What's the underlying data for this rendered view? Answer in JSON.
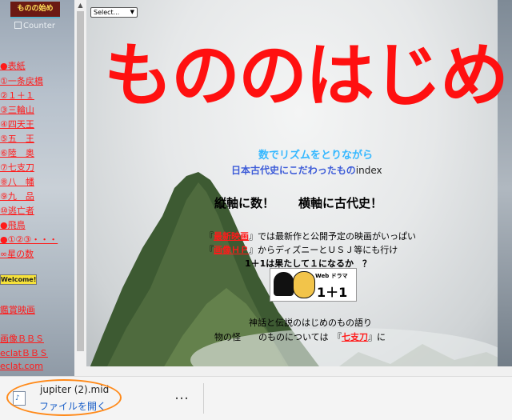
{
  "sidebar": {
    "logo_text": "ものの始め",
    "counter_alt": "Counter",
    "items": [
      "●表紙",
      "①一条戻橋",
      "②１＋１",
      "③三輪山",
      "④四天王",
      "⑤五　王",
      "⑥陸　奥",
      "⑦七支刀",
      "⑧八　幡",
      "⑨九　品",
      "⑩逃亡者",
      "●飛鳥",
      "●①②③・・・",
      "∞星の数"
    ],
    "welcome": "Welcome!",
    "lower_items": [
      "鑑賞映画",
      "画像ＢＢＳ",
      "eclatＢＢＳ",
      "eclat.com"
    ]
  },
  "main": {
    "select_label": "Select...",
    "big_title": "もののはじめ",
    "subtitle1": "数でリズムをとりながら",
    "subtitle2": "日本古代史にこだわったもの",
    "subtitle2_suffix": "index",
    "slogan": "縦軸に数！　　横軸に古代史！",
    "line1_prefix": "『",
    "line1_link": "最新映画",
    "line1_suffix": "』では最新作と公開予定の映画がいっぱい",
    "line2_prefix": "『",
    "line2_link": "画像ＨＰ",
    "line2_suffix": "』からディズニーとＵＳＪ等にも行け",
    "line3": "1＋1は果たして１になるか　？",
    "webdrama_label": "Web ドラマ",
    "webdrama_title": "1＋1",
    "line4": "神話と伝説のはじめのもの語り",
    "line5_prefix": "物の怪　　のものについては　『",
    "line5_link": "七支刀",
    "line5_suffix": "』に"
  },
  "download": {
    "filename": "jupiter (2).mid",
    "open_label": "ファイルを開く",
    "more_label": "…"
  },
  "colors": {
    "title_red": "#ff1010",
    "link_red": "#ff1a1a",
    "highlight_orange": "#ff8a1a"
  }
}
